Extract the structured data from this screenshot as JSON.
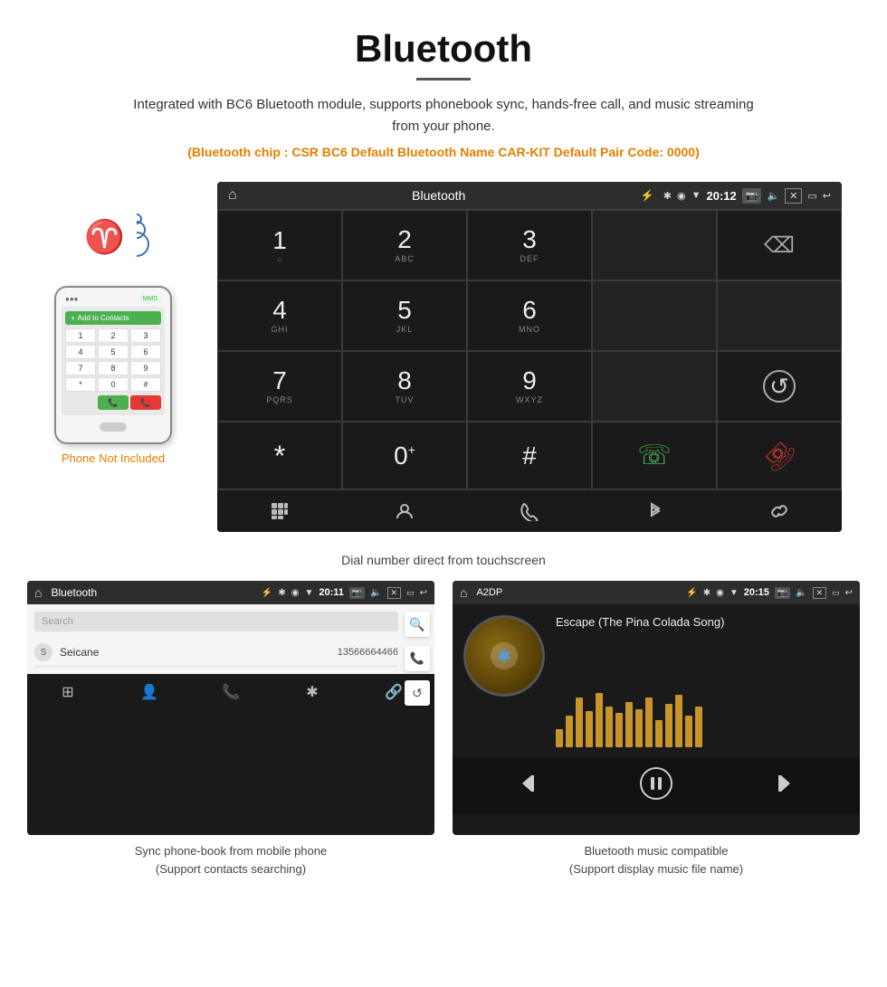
{
  "page": {
    "title": "Bluetooth",
    "subtitle": "Integrated with BC6 Bluetooth module, supports phonebook sync, hands-free call, and music streaming from your phone.",
    "specs": "(Bluetooth chip : CSR BC6    Default Bluetooth Name CAR-KIT    Default Pair Code: 0000)",
    "dial_caption": "Dial number direct from touchscreen",
    "phonebook_caption": "Sync phone-book from mobile phone\n(Support contacts searching)",
    "music_caption": "Bluetooth music compatible\n(Support display music file name)",
    "phone_not_included": "Phone Not Included"
  },
  "dialpad_screen": {
    "title": "Bluetooth",
    "time": "20:12",
    "keys": [
      {
        "num": "1",
        "sub": ""
      },
      {
        "num": "2",
        "sub": "ABC"
      },
      {
        "num": "3",
        "sub": "DEF"
      },
      {
        "num": "",
        "sub": ""
      },
      {
        "num": "⌫",
        "sub": ""
      },
      {
        "num": "4",
        "sub": "GHI"
      },
      {
        "num": "5",
        "sub": "JKL"
      },
      {
        "num": "6",
        "sub": "MNO"
      },
      {
        "num": "",
        "sub": ""
      },
      {
        "num": "",
        "sub": ""
      },
      {
        "num": "7",
        "sub": "PQRS"
      },
      {
        "num": "8",
        "sub": "TUV"
      },
      {
        "num": "9",
        "sub": "WXYZ"
      },
      {
        "num": "",
        "sub": ""
      },
      {
        "num": "↺",
        "sub": ""
      },
      {
        "num": "*",
        "sub": ""
      },
      {
        "num": "0",
        "sub": "+"
      },
      {
        "num": "#",
        "sub": ""
      },
      {
        "num": "✆",
        "sub": "green"
      },
      {
        "num": "✆",
        "sub": "red"
      }
    ]
  },
  "phonebook_screen": {
    "title": "Bluetooth",
    "time": "20:11",
    "search_placeholder": "Search",
    "contact_name": "Seicane",
    "contact_phone": "13566664466",
    "contact_letter": "S"
  },
  "music_screen": {
    "title": "A2DP",
    "time": "20:15",
    "song_title": "Escape (The Pina Colada Song)",
    "eq_bars": [
      20,
      35,
      55,
      40,
      60,
      45,
      38,
      50,
      42,
      55,
      30,
      48,
      58,
      35,
      45
    ]
  },
  "icons": {
    "home": "⌂",
    "usb": "⚡",
    "bluetooth": "✱",
    "location": "◉",
    "wifi": "▲",
    "camera": "📷",
    "volume": "🔊",
    "close": "✕",
    "window": "▭",
    "back": "↩",
    "grid": "⊞",
    "person": "👤",
    "phone": "📞",
    "link": "🔗",
    "prev": "⏮",
    "play": "⏯",
    "next": "⏭"
  }
}
